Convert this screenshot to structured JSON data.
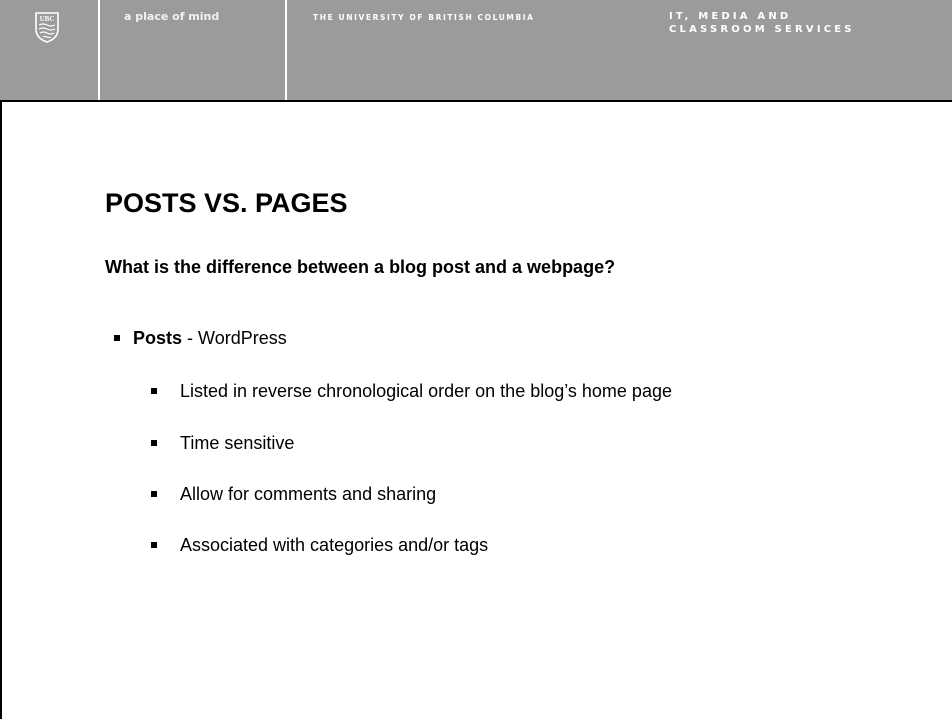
{
  "banner": {
    "logo_text": "UBC",
    "tagline": "a place of mind",
    "university": "THE UNIVERSITY OF BRITISH COLUMBIA",
    "dept_line1": "IT, MEDIA AND",
    "dept_line2": "CLASSROOM SERVICES"
  },
  "slide": {
    "title": "POSTS VS. PAGES",
    "subtitle": "What is the difference between a blog post and a webpage?",
    "bullet": {
      "bold": "Posts",
      "rest": " - WordPress"
    },
    "sub_bullets": [
      "Listed in reverse chronological order on the blog’s home page",
      "Time sensitive",
      "Allow for comments and sharing",
      "Associated with categories and/or tags"
    ]
  }
}
